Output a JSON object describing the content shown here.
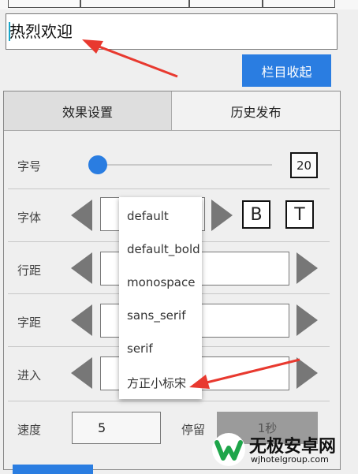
{
  "text_input": {
    "value": "热烈欢迎"
  },
  "collapse_button": {
    "label": "栏目收起"
  },
  "tabs": [
    {
      "label": "效果设置",
      "selected": true
    },
    {
      "label": "历史发布",
      "selected": false
    }
  ],
  "rows": {
    "size": {
      "label": "字号",
      "value": "20"
    },
    "font": {
      "label": "字体",
      "bold_label": "B",
      "text_label": "T"
    },
    "line_spacing": {
      "label": "行距"
    },
    "letter_spacing": {
      "label": "字距"
    },
    "enter": {
      "label": "进入"
    },
    "speed": {
      "label": "速度",
      "value": "5"
    },
    "stay": {
      "label": "停留",
      "value": "1秒"
    }
  },
  "dropdown": {
    "options": [
      "default",
      "default_bold",
      "monospace",
      "sans_serif",
      "serif",
      "方正小标宋"
    ]
  },
  "watermark": {
    "title": "无极安卓网",
    "url": "wjhotelgroup.com"
  },
  "colors": {
    "accent": "#2a7de1",
    "arrow": "#e8392f"
  }
}
